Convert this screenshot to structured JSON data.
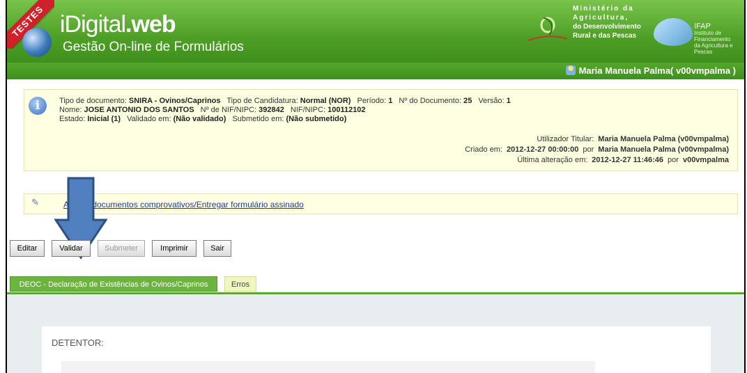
{
  "header": {
    "badge": "TESTES",
    "app_name_light": "iDigital",
    "app_name_bold": ".web",
    "subtitle": "Gestão On-line de Formulários",
    "ministry_lines": [
      "Ministério da",
      "Agricultura,",
      "do Desenvolvimento",
      "Rural e das Pescas"
    ],
    "ifap_short": "IFAP",
    "ifap_lines": [
      "Instituto de Financiamento",
      "da Agricultura e Pescas"
    ]
  },
  "user": {
    "name": "Maria Manuela Palma( v00vmpalma )"
  },
  "info": {
    "tipo_documento_label": "Tipo de documento:",
    "tipo_documento": "SNIRA - Ovinos/Caprinos",
    "tipo_candidatura_label": "Tipo de Candidatura:",
    "tipo_candidatura": "Normal (NOR)",
    "periodo_label": "Período:",
    "periodo": "1",
    "num_documento_label": "Nº do Documento:",
    "num_documento": "25",
    "versao_label": "Versão:",
    "versao": "1",
    "nome_label": "Nome:",
    "nome": "JOSE ANTONIO DOS SANTOS",
    "nif_label": "Nº de NIF/NIPC:",
    "nif": "392842",
    "nipc_label": "NIF/NIPC:",
    "nipc": "100112102",
    "estado_label": "Estado:",
    "estado": "Inicial (1)",
    "validado_label": "Validado em:",
    "validado": "(Não validado)",
    "submetido_label": "Submetido em:",
    "submetido": "(Não submetido)",
    "utilizador_label": "Utilizador Titular:",
    "utilizador": "Maria Manuela Palma (v00vmpalma)",
    "criado_label": "Criado em:",
    "criado": "2012-12-27 00:00:00",
    "por_label": "por",
    "criado_por": "Maria Manuela Palma (v00vmpalma)",
    "alteracao_label": "Última alteração em:",
    "alteracao": "2012-12-27 11:46:46",
    "alteracao_por": "v00vmpalma"
  },
  "attach": {
    "link_text": "Anexar documentos comprovativos/Entregar formulário assinado"
  },
  "buttons": {
    "editar": "Editar",
    "validar": "Validar",
    "submeter": "Submeter",
    "imprimir": "Imprimir",
    "sair": "Sair"
  },
  "tabs": [
    {
      "label": "DEOC - Declaração de Existências de Ovinos/Caprinos"
    },
    {
      "label": "Erros"
    }
  ],
  "content": {
    "section_title": "DETENTOR:"
  },
  "colors": {
    "header_green": "#4e9f26",
    "info_bg": "#ffffe1",
    "arrow_blue": "#4f7fbf"
  }
}
